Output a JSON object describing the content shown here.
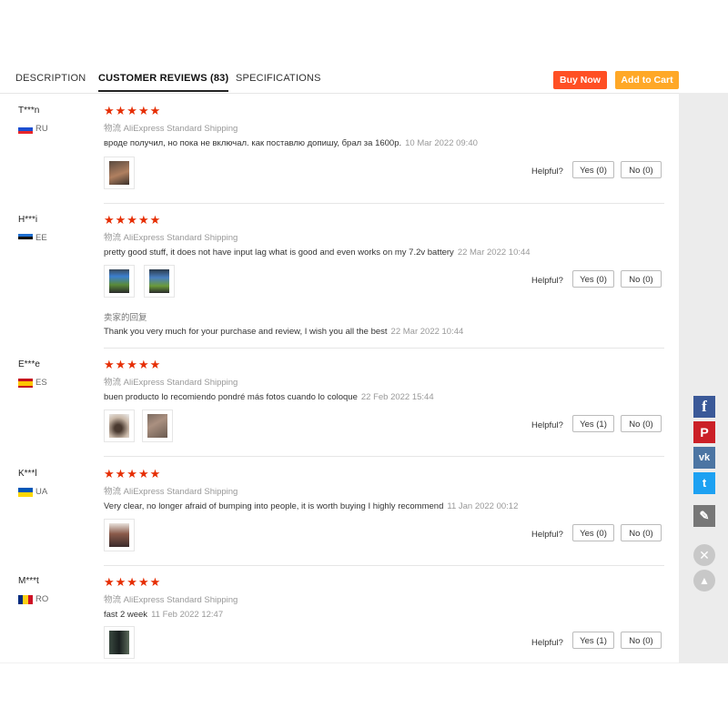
{
  "tabs": {
    "description": "DESCRIPTION",
    "reviews": "CUSTOMER REVIEWS (83)",
    "specifications": "SPECIFICATIONS"
  },
  "actions": {
    "buy_now": "Buy Now",
    "add_to_cart": "Add to Cart"
  },
  "colors": {
    "buy": "#ff4f24",
    "cart": "#ffa827",
    "stars": "#e62e04"
  },
  "shipping_prefix": "物流",
  "shipping_method": "AliExpress Standard Shipping",
  "helpful_label": "Helpful?",
  "stars": "★★★★★",
  "reviews": [
    {
      "user": "T***n",
      "country": "RU",
      "text": "вроде получил, но пока не включал. как поставлю допишу, брал за 1600р.",
      "date": "10 Mar 2022 09:40",
      "yes": "Yes (0)",
      "no": "No (0)"
    },
    {
      "user": "H***i",
      "country": "EE",
      "text": "pretty good stuff, it does not have input lag what is good and even works on my 7.2v battery",
      "date": "22 Mar 2022 10:44",
      "yes": "Yes (0)",
      "no": "No (0)",
      "seller_label": "卖家的回复",
      "seller_reply": "Thank you very much for your purchase and review, I wish you all the best",
      "seller_date": "22 Mar 2022 10:44"
    },
    {
      "user": "E***e",
      "country": "ES",
      "text": "buen producto lo recomiendo pondré más fotos cuando lo coloque",
      "date": "22 Feb 2022 15:44",
      "yes": "Yes (1)",
      "no": "No (0)"
    },
    {
      "user": "K***l",
      "country": "UA",
      "text": "Very clear, no longer afraid of bumping into people, it is worth buying I highly recommend",
      "date": "11 Jan 2022 00:12",
      "yes": "Yes (0)",
      "no": "No (0)"
    },
    {
      "user": "M***t",
      "country": "RO",
      "text": "fast 2 week",
      "date": "11 Feb 2022 12:47",
      "yes": "Yes (1)",
      "no": "No (0)"
    }
  ],
  "share_icons": [
    "facebook-icon",
    "pinterest-icon",
    "vk-icon",
    "twitter-icon",
    "edit-icon"
  ]
}
